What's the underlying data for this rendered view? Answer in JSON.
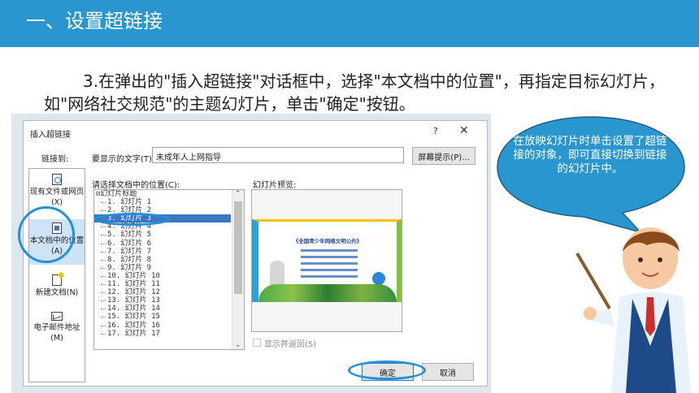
{
  "slide": {
    "header_title": "一、设置超链接",
    "instruction": "3.在弹出的\"插入超链接\"对话框中，选择\"本文档中的位置\"，再指定目标幻灯片，如\"网络社交规范\"的主题幻灯片，单击\"确定\"按钮。",
    "callout": "在放映幻灯片时单击设置了超链接的对象，即可直接切换到链接的幻灯片中。"
  },
  "dialog": {
    "title": "插入超链接",
    "help": "?",
    "close": "✕",
    "link_to_label": "链接到:",
    "text_to_display_label": "要显示的文字(T):",
    "text_to_display_value": "未成年人上网指导",
    "screen_tip_button": "屏幕提示(P)...",
    "nav_items": [
      {
        "label": "现有文件或网页(X)",
        "icon": "globe-file-icon"
      },
      {
        "label": "本文档中的位置(A)",
        "icon": "document-place-icon"
      },
      {
        "label": "新建文档(N)",
        "icon": "new-document-icon"
      },
      {
        "label": "电子邮件地址(M)",
        "icon": "email-icon"
      }
    ],
    "place_label": "请选择文档中的位置(C):",
    "tree_root": "幻灯片标题",
    "tree_items": [
      "1. 幻灯片 1",
      "2. 幻灯片 2",
      "3. 幻灯片 3",
      "4. 幻灯片 4",
      "5. 幻灯片 5",
      "6. 幻灯片 6",
      "7. 幻灯片 7",
      "8. 幻灯片 8",
      "9. 幻灯片 9",
      "10. 幻灯片 10",
      "11. 幻灯片 11",
      "12. 幻灯片 12",
      "13. 幻灯片 13",
      "14. 幻灯片 14",
      "15. 幻灯片 15",
      "16. 幻灯片 16",
      "17. 幻灯片 17"
    ],
    "selected_index": 2,
    "preview_label": "幻灯片预览:",
    "preview_thumb_title": "《全国青少年网络文明公约》",
    "show_return_label": "显示并返回(S)",
    "ok_button": "确定",
    "cancel_button": "取消"
  },
  "colors": {
    "header": "#2a96cf",
    "highlight_ring": "#2490d6",
    "callout_fill": "#2a96cf",
    "selection": "#3a78c4"
  }
}
